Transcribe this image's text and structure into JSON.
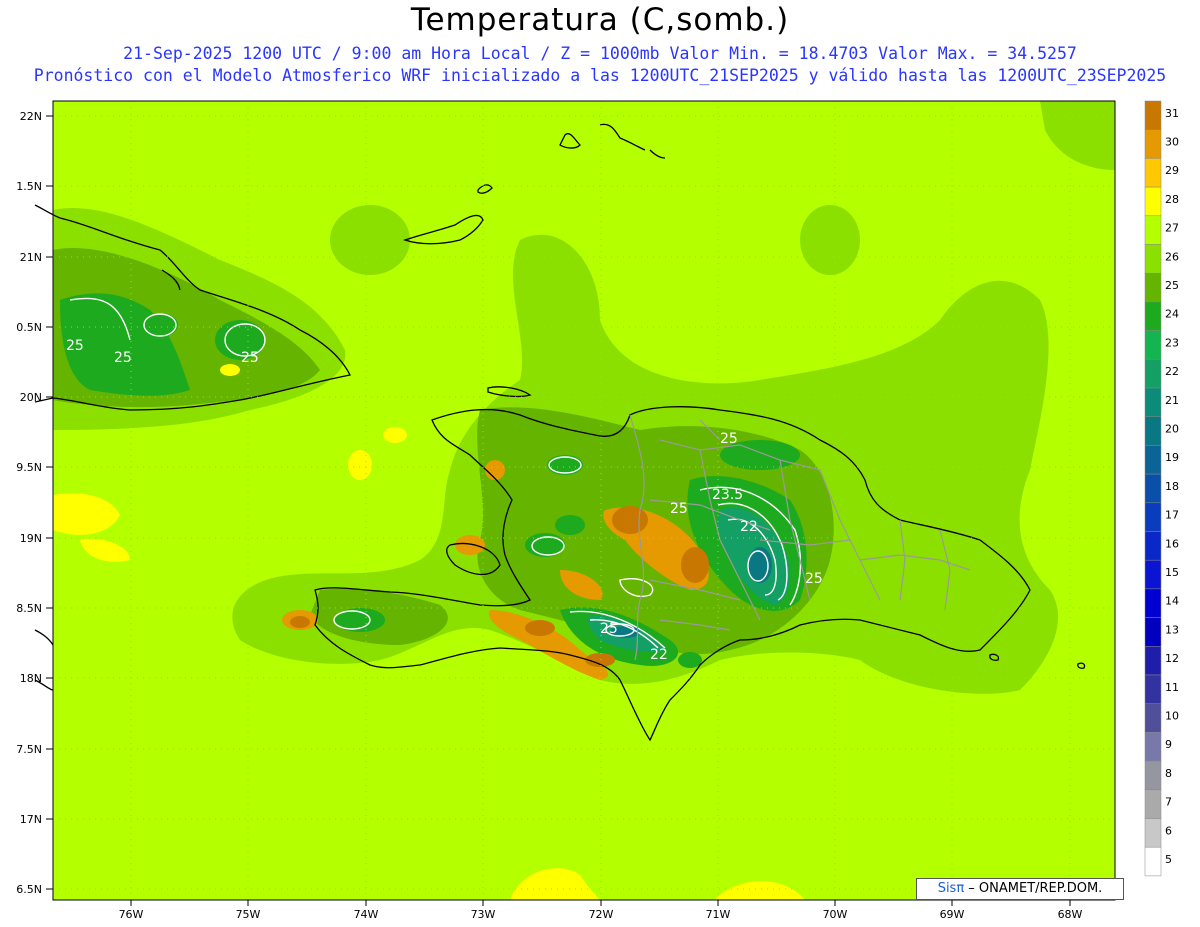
{
  "title": "Temperatura (C,somb.)",
  "subtitle_line1": "21-Sep-2025  1200 UTC / 9:00 am Hora Local / Z = 1000mb   Valor Min. = 18.4703  Valor Max. = 34.5257",
  "subtitle_line2": "Pronóstico con el Modelo Atmosferico WRF inicializado a las 1200UTC_21SEP2025 y válido hasta las  1200UTC_23SEP2025",
  "credit": {
    "sis": "Sisπ",
    "rest": " – ONAMET/REP.DOM."
  },
  "lat_labels": [
    "22N",
    "1.5N",
    "21N",
    "0.5N",
    "20N",
    "9.5N",
    "19N",
    "8.5N",
    "18N",
    "7.5N",
    "17N",
    "6.5N"
  ],
  "lon_labels": [
    "76W",
    "75W",
    "74W",
    "73W",
    "72W",
    "71W",
    "70W",
    "69W",
    "68W"
  ],
  "contour_labels": [
    "25",
    "25",
    "25",
    "25",
    "25",
    "25",
    "23.5",
    "22",
    "25",
    "22"
  ],
  "legend": {
    "values": [
      "31",
      "30",
      "29",
      "28",
      "27",
      "26",
      "25",
      "24",
      "23",
      "22",
      "21",
      "20",
      "19",
      "18",
      "17",
      "16",
      "15",
      "14",
      "13",
      "12",
      "11",
      "10",
      "9",
      "8",
      "7",
      "6",
      "5"
    ],
    "colors": [
      "#c87800",
      "#e49a00",
      "#ffc800",
      "#ffff00",
      "#b4ff00",
      "#8ce000",
      "#64b400",
      "#1eaa1e",
      "#14b450",
      "#14a064",
      "#0a8c78",
      "#0a7882",
      "#0a6496",
      "#0a50aa",
      "#0a3cbe",
      "#0a28c8",
      "#0a14d2",
      "#0000d2",
      "#0000be",
      "#1e1eaa",
      "#3232a0",
      "#50509a",
      "#7878aa",
      "#9696a0",
      "#aaaaaa",
      "#c8c8c8",
      "#ffffff"
    ]
  }
}
